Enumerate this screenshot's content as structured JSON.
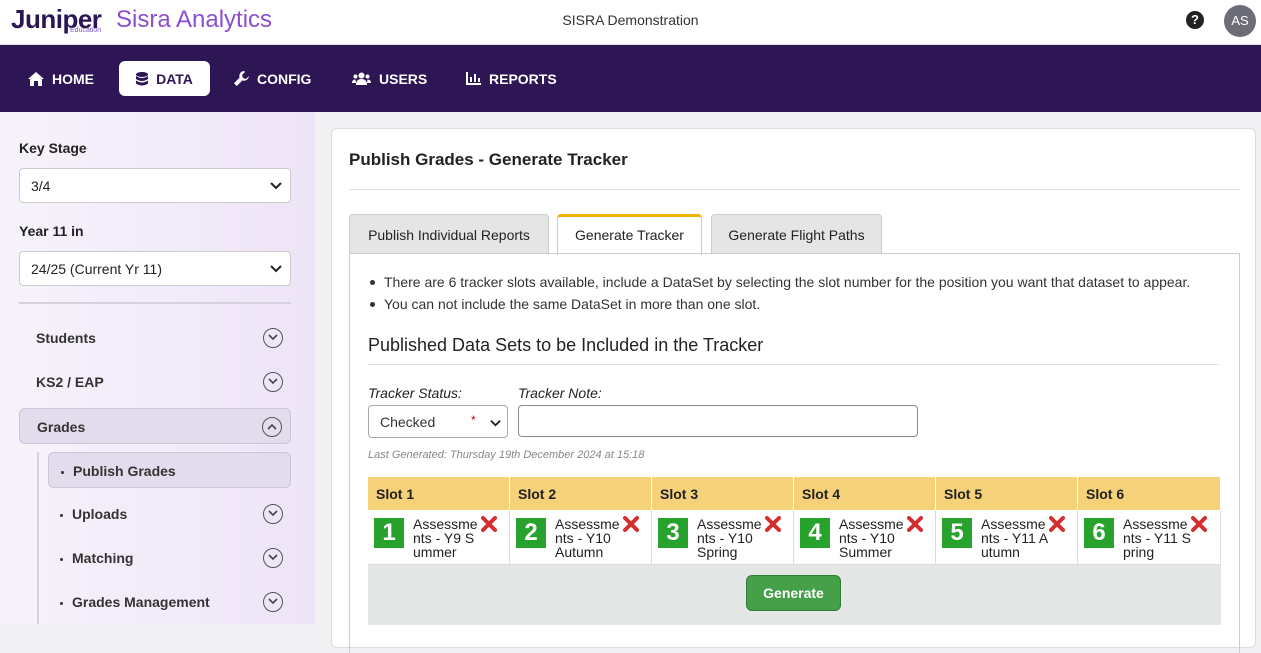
{
  "header": {
    "brand": "Juniper",
    "brand_sub": "Education",
    "product": "Sisra Analytics",
    "org": "SISRA Demonstration",
    "help_icon": "question-circle-icon",
    "avatar_initials": "AS"
  },
  "nav": {
    "items": [
      {
        "label": "HOME",
        "icon": "home-icon"
      },
      {
        "label": "DATA",
        "icon": "database-icon",
        "active": true
      },
      {
        "label": "CONFIG",
        "icon": "wrench-icon"
      },
      {
        "label": "USERS",
        "icon": "users-icon"
      },
      {
        "label": "REPORTS",
        "icon": "bar-chart-icon"
      }
    ]
  },
  "sidebar": {
    "key_stage_label": "Key Stage",
    "key_stage_value": "3/4",
    "year_label": "Year 11 in",
    "year_value": "24/25 (Current Yr 11)",
    "items": [
      {
        "label": "Students"
      },
      {
        "label": "KS2 / EAP"
      },
      {
        "label": "Grades",
        "expanded": true
      }
    ],
    "sub_items": [
      {
        "label": "Publish Grades",
        "active": true
      },
      {
        "label": "Uploads"
      },
      {
        "label": "Matching"
      },
      {
        "label": "Grades Management"
      }
    ]
  },
  "main": {
    "title": "Publish Grades - Generate Tracker",
    "tabs": [
      {
        "label": "Publish Individual Reports"
      },
      {
        "label": "Generate Tracker",
        "active": true
      },
      {
        "label": "Generate Flight Paths"
      }
    ],
    "bullets": [
      "There are 6 tracker slots available, include a DataSet by selecting the slot number for the position you want that dataset to appear.",
      "You can not include the same DataSet in more than one slot."
    ],
    "section_title": "Published Data Sets to be Included in the Tracker",
    "tracker_status_label": "Tracker Status:",
    "tracker_status_value": "Checked",
    "tracker_status_required": "*",
    "tracker_note_label": "Tracker Note:",
    "tracker_note_value": "",
    "last_generated": "Last Generated: Thursday 19th December 2024 at 15:18",
    "slots": [
      {
        "header": "Slot 1",
        "num": "1",
        "text": "Assessments - Y9 Summer"
      },
      {
        "header": "Slot 2",
        "num": "2",
        "text": "Assessments - Y10 Autumn"
      },
      {
        "header": "Slot 3",
        "num": "3",
        "text": "Assessments - Y10 Spring"
      },
      {
        "header": "Slot 4",
        "num": "4",
        "text": "Assessments - Y10 Summer"
      },
      {
        "header": "Slot 5",
        "num": "5",
        "text": "Assessments - Y11 Autumn"
      },
      {
        "header": "Slot 6",
        "num": "6",
        "text": "Assessments - Y11 Spring"
      }
    ],
    "generate_label": "Generate"
  },
  "colors": {
    "nav_bg": "#2e1655",
    "accent_tab": "#f0b400",
    "slot_header": "#f5d27a",
    "slot_number": "#27a22c",
    "remove": "#d32f2f",
    "button": "#46a049"
  }
}
